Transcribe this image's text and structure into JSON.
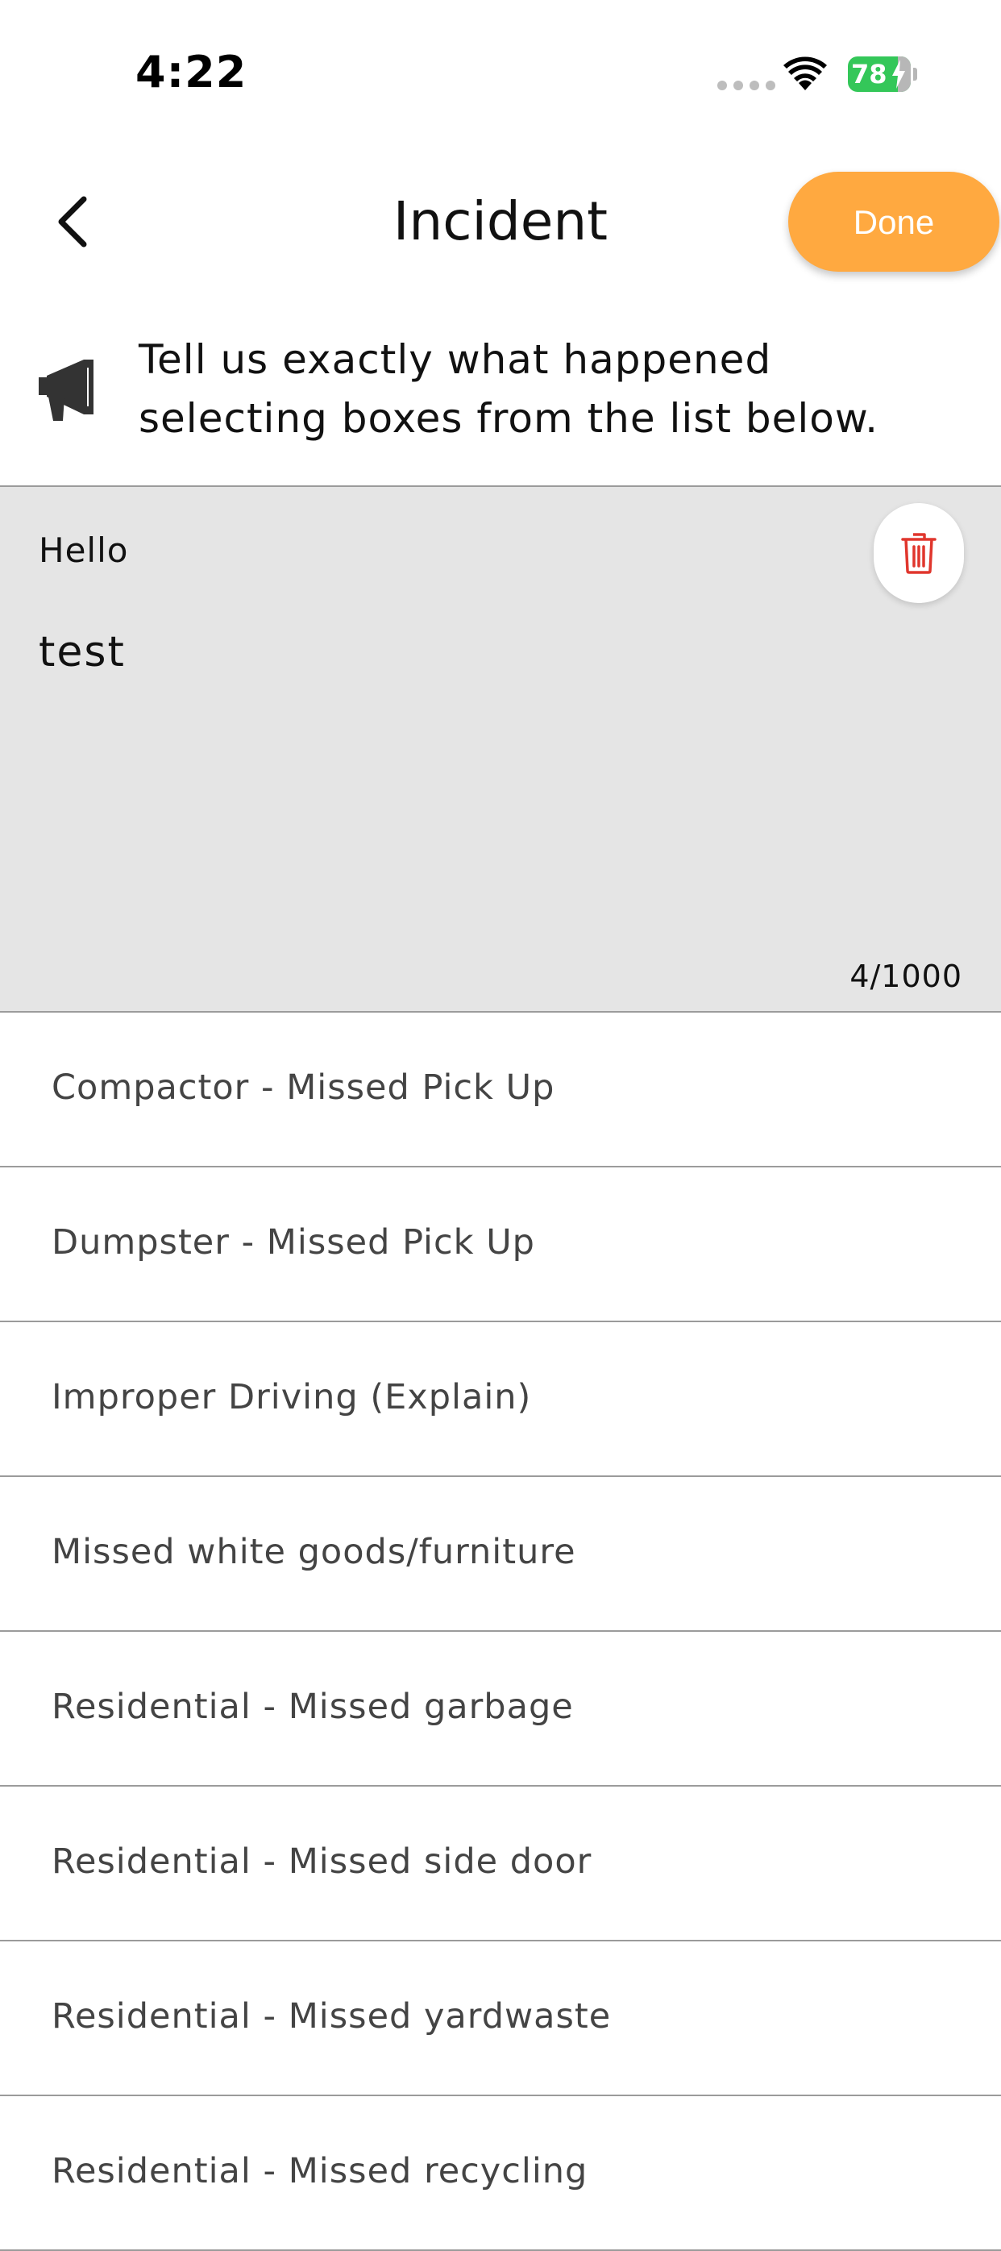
{
  "status_bar": {
    "time": "4:22",
    "battery_level": "78"
  },
  "header": {
    "title": "Incident",
    "done_label": "Done",
    "accent_color": "#ffa940"
  },
  "instruction": {
    "text": "Tell us exactly what happened selecting boxes from the list below.",
    "icon": "megaphone-icon"
  },
  "note": {
    "label": "Hello",
    "text": "test",
    "char_count": "4/1000"
  },
  "incident_types": [
    {
      "label": "Compactor - Missed Pick Up"
    },
    {
      "label": "Dumpster - Missed Pick Up"
    },
    {
      "label": "Improper Driving (Explain)"
    },
    {
      "label": "Missed white goods/furniture"
    },
    {
      "label": "Residential - Missed garbage"
    },
    {
      "label": "Residential - Missed side door"
    },
    {
      "label": "Residential - Missed yardwaste"
    },
    {
      "label": "Residential - Missed recycling"
    }
  ]
}
